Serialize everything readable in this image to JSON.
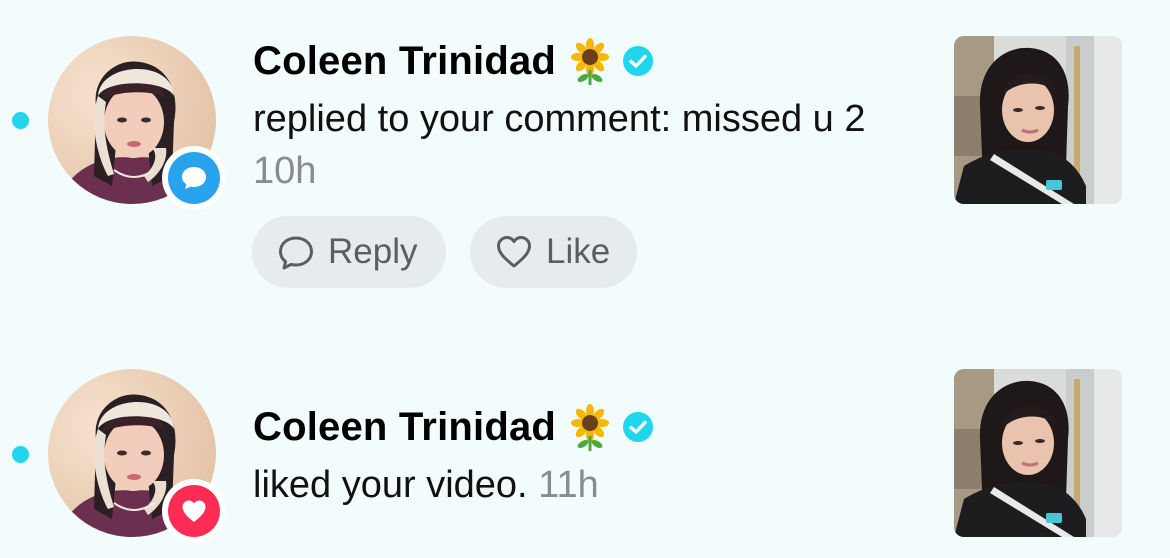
{
  "notifications": [
    {
      "user_name": "Coleen Trinidad",
      "name_emoji": "🌻",
      "message": "replied to your comment: missed u 2",
      "timestamp": "10h",
      "type_icon": "comment-icon",
      "badge_color": "#2aa3ef",
      "unread": true,
      "actions": {
        "reply_label": "Reply",
        "like_label": "Like"
      }
    },
    {
      "user_name": "Coleen Trinidad",
      "name_emoji": "🌻",
      "message": "liked your video.",
      "timestamp": "11h",
      "type_icon": "heart-icon",
      "badge_color": "#fe2c55",
      "unread": true
    }
  ],
  "colors": {
    "background": "#f3fcfd",
    "unread_dot": "#20d5ec",
    "verified": "#20d5ec",
    "timestamp": "#8a8b91",
    "button_bg": "#e6ecee"
  }
}
